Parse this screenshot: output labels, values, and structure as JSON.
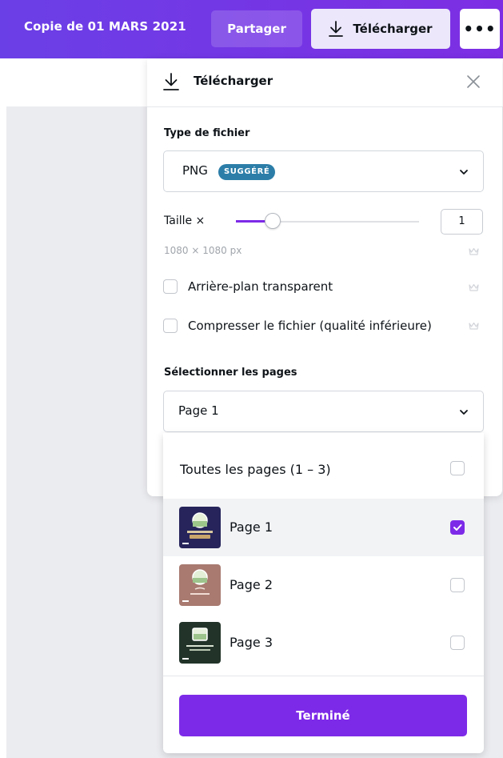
{
  "header": {
    "doc_title": "Copie de 01 MARS 2021",
    "share_label": "Partager",
    "download_label": "Télécharger",
    "more_label": "•••"
  },
  "panel": {
    "title": "Télécharger",
    "file_type_label": "Type de fichier",
    "file_type_value": "PNG",
    "suggested_badge": "SUGGÉRÉ",
    "size_label": "Taille ×",
    "size_value": "1",
    "size_fraction": 0.2,
    "dimensions": "1080 × 1080 px",
    "transparent_label": "Arrière-plan transparent",
    "compress_label": "Compresser le fichier (qualité inférieure)",
    "pages_label": "Sélectionner les pages",
    "pages_value": "Page 1"
  },
  "dropdown": {
    "all_pages_label": "Toutes les pages (1 – 3)",
    "pages": [
      {
        "label": "Page 1",
        "checked": true,
        "thumb_color": "#2a2a5e"
      },
      {
        "label": "Page 2",
        "checked": false,
        "thumb_color": "#a4756c"
      },
      {
        "label": "Page 3",
        "checked": false,
        "thumb_color": "#24352b"
      }
    ],
    "done_label": "Terminé"
  },
  "colors": {
    "accent": "#7d2ae8",
    "badge": "#2c7ea8"
  }
}
